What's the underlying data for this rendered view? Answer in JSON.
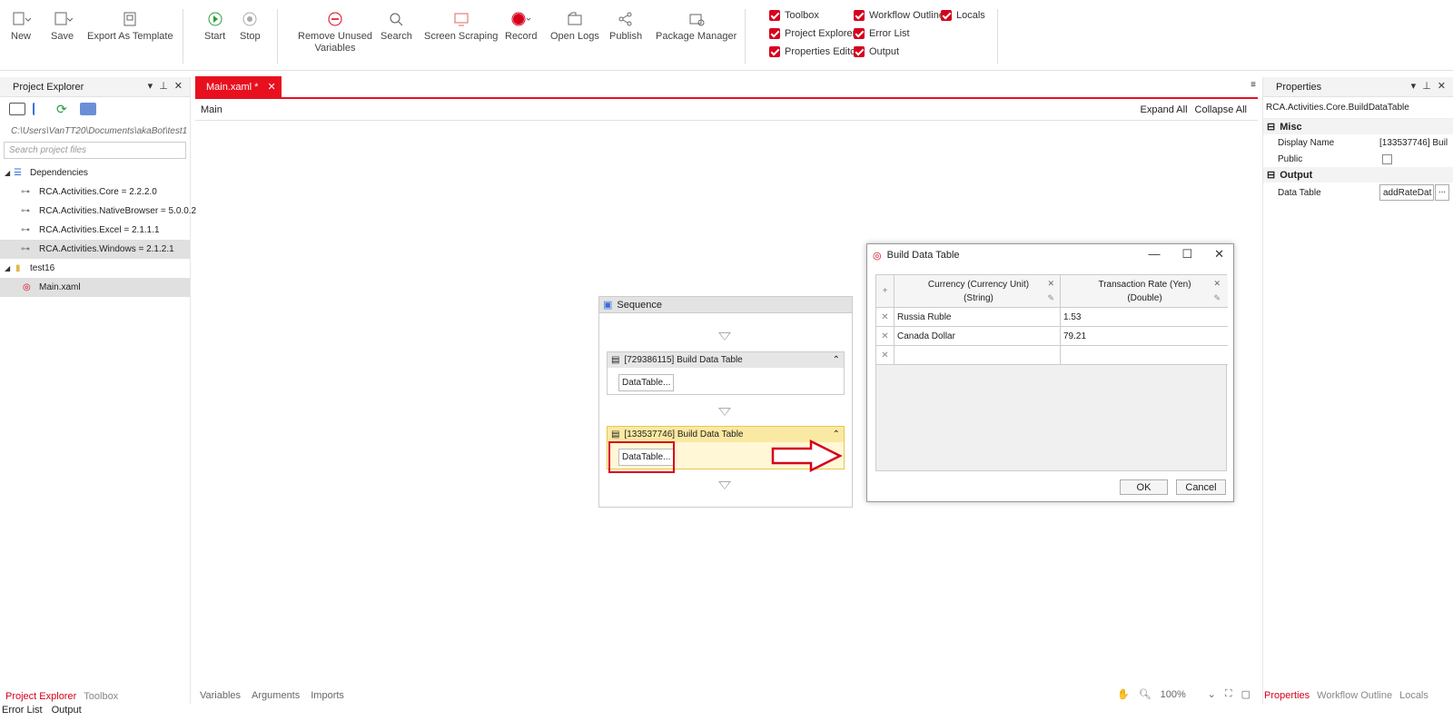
{
  "ribbon": {
    "new": "New",
    "save": "Save",
    "export_template": "Export As Template",
    "start": "Start",
    "stop": "Stop",
    "remove_unused_1": "Remove Unused",
    "remove_unused_2": "Variables",
    "search": "Search",
    "screen_scraping": "Screen Scraping",
    "record": "Record",
    "open_logs": "Open Logs",
    "publish": "Publish",
    "package_manager": "Package Manager",
    "checks": {
      "toolbox": "Toolbox",
      "project_explorer": "Project Explorer",
      "properties_editor": "Properties Editor",
      "workflow_outline": "Workflow Outline",
      "error_list": "Error List",
      "output": "Output",
      "locals": "Locals"
    }
  },
  "project_explorer": {
    "title": "Project Explorer",
    "path": "C:\\Users\\VanTT20\\Documents\\akaBot\\test1",
    "search_placeholder": "Search project files",
    "dependencies_label": "Dependencies",
    "dependencies": [
      "RCA.Activities.Core = 2.2.2.0",
      "RCA.Activities.NativeBrowser = 5.0.0.2",
      "RCA.Activities.Excel = 2.1.1.1",
      "RCA.Activities.Windows = 2.1.2.1"
    ],
    "project": "test16",
    "file": "Main.xaml"
  },
  "bottom_left_tabs": [
    "Project Explorer",
    "Toolbox"
  ],
  "bottom_left_tabs2": [
    "Error List",
    "Output"
  ],
  "document": {
    "tab": "Main.xaml *",
    "crumb": "Main",
    "expand_all": "Expand All",
    "collapse_all": "Collapse All"
  },
  "sequence": {
    "title": "Sequence",
    "activities": [
      {
        "title": "[729386115] Build Data Table",
        "button": "DataTable..."
      },
      {
        "title": "[133537746] Build Data Table",
        "button": "DataTable..."
      }
    ]
  },
  "dialog": {
    "title": "Build Data Table",
    "col1_line1": "Currency (Currency Unit)",
    "col1_line2": "(String)",
    "col2_line1": "Transaction Rate (Yen)",
    "col2_line2": "(Double)",
    "rows": [
      {
        "currency": "Russia Ruble",
        "rate": "1.53"
      },
      {
        "currency": "Canada Dollar",
        "rate": "79.21"
      }
    ],
    "ok": "OK",
    "cancel": "Cancel"
  },
  "properties": {
    "title": "Properties",
    "type": "RCA.Activities.Core.BuildDataTable",
    "misc": "Misc",
    "display_name_label": "Display Name",
    "display_name_value": "[133537746] Buil",
    "public_label": "Public",
    "output": "Output",
    "data_table_label": "Data Table",
    "data_table_value": "addRateDat",
    "ellipsis": "..."
  },
  "bottom_right_tabs": [
    "Properties",
    "Workflow Outline",
    "Locals"
  ],
  "bottom_mid_tabs": [
    "Variables",
    "Arguments",
    "Imports"
  ],
  "zoom": "100%",
  "accent": "#e8101f"
}
